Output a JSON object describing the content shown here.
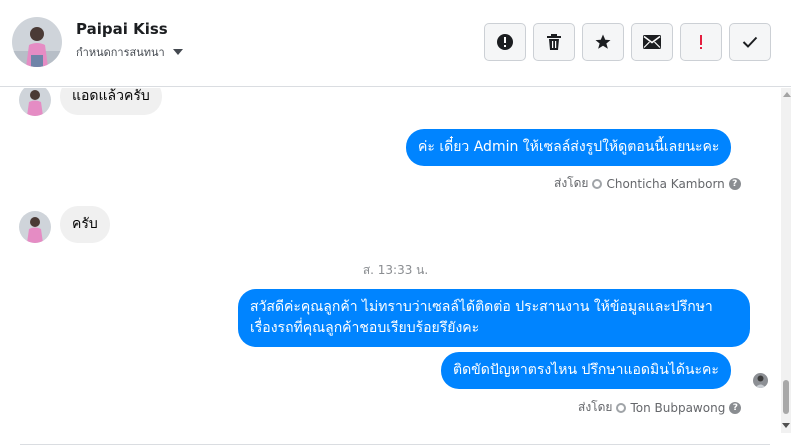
{
  "header": {
    "name": "Paipai Kiss",
    "label_dropdown": "กำหนดการสนทนา",
    "actions": [
      {
        "name": "report-icon"
      },
      {
        "name": "trash-icon"
      },
      {
        "name": "star-icon"
      },
      {
        "name": "envelope-icon"
      },
      {
        "name": "exclamation-icon",
        "color": "#e41e3f"
      },
      {
        "name": "check-icon"
      }
    ]
  },
  "messages": {
    "m1": "แอดแล้วครับ",
    "m2": "ค่ะ เดี๋ยว Admin ให้เซลล์ส่งรูปให้ดูตอนนี้เลยนะคะ",
    "m2_sent_prefix": "ส่งโดย",
    "m2_sender": "Chonticha Kamborn",
    "m3": "ครับ",
    "timestamp": "ส. 13:33 น.",
    "m4": "สวัสดีค่ะคุณลูกค้า ไม่ทราบว่าเซลล์ได้ติดต่อ ประสานงาน ให้ข้อมูลและปรึกษาเรื่องรถที่คุณลูกค้าชอบเรียบร้อยรึยังคะ",
    "m5": "ติดขัดปัญหาตรงไหน ปรึกษาแอดมินได้นะคะ",
    "m5_sent_prefix": "ส่งโดย",
    "m5_sender": "Ton Bubpawong"
  },
  "colors": {
    "outgoing_bubble": "#0084ff",
    "incoming_bubble": "#f0f0f0"
  }
}
